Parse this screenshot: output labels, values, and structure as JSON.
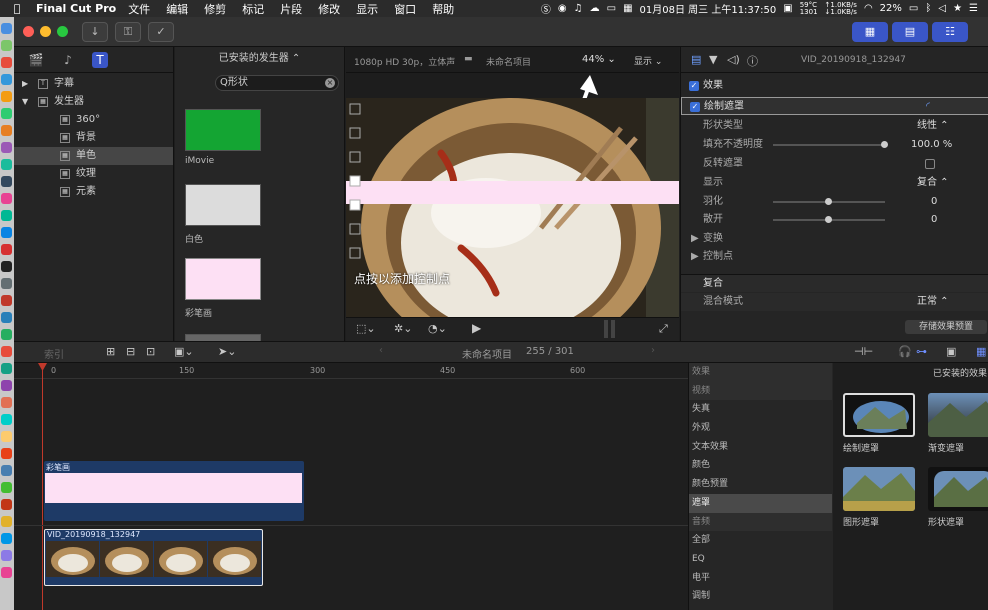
{
  "menubar": {
    "app_name": "Final Cut Pro",
    "items": [
      "文件",
      "编辑",
      "修剪",
      "标记",
      "片段",
      "修改",
      "显示",
      "窗口",
      "帮助"
    ],
    "clock": "01月08日 周三 上午11:37:50",
    "battery": "22%",
    "temp": "59°C\n1301",
    "net_up": "↑1.0KB/s",
    "net_down": "↓1.0KB/s"
  },
  "toolbar": {
    "import_icon": "download-icon",
    "keywords_icon": "key-icon",
    "background_tasks_icon": "check-circle-icon"
  },
  "library": {
    "tree": [
      {
        "label": "字幕",
        "level": 0,
        "collapsed": true,
        "icon_text": "T"
      },
      {
        "label": "发生器",
        "level": 0,
        "collapsed": false,
        "icon_text": "▦"
      },
      {
        "label": "360°",
        "level": 1,
        "icon_text": "▦"
      },
      {
        "label": "背景",
        "level": 1,
        "icon_text": "▦"
      },
      {
        "label": "单色",
        "level": 1,
        "selected": true,
        "icon_text": "▦"
      },
      {
        "label": "纹理",
        "level": 1,
        "icon_text": "▦"
      },
      {
        "label": "元素",
        "level": 1,
        "icon_text": "▦"
      }
    ]
  },
  "generators": {
    "header": "已安装的发生器 ⌃",
    "search_value": "Q形状",
    "items": [
      {
        "label": "iMovie",
        "color": "#14a533"
      },
      {
        "label": "白色",
        "color": "#dcdcdc"
      },
      {
        "label": "彩笔画",
        "color": "#fde0f4"
      }
    ]
  },
  "viewer": {
    "format": "1080p HD 30p，立体声",
    "project": "未命名项目",
    "zoom": "44% ⌄",
    "display": "显示 ⌄",
    "overlay_text": "点按以添加控制点",
    "band_color": "#fde0f4"
  },
  "inspector": {
    "clip_name": "VID_20190918_132947",
    "effects_label": "效果",
    "draw_mask_label": "绘制遮罩",
    "shape_type_label": "形状类型",
    "shape_type_value": "线性 ⌃",
    "fill_opacity_label": "填充不透明度",
    "fill_opacity_value": "100.0 %",
    "fill_opacity_level": 1.0,
    "invert_label": "反转遮罩",
    "display_label": "显示",
    "display_value": "复合 ⌃",
    "feather_label": "羽化",
    "feather_value": "0",
    "spread_label": "散开",
    "spread_value": "0",
    "transform_label": "变换",
    "control_points_label": "控制点",
    "composite_label": "复合",
    "blend_mode_label": "混合模式",
    "blend_mode_value": "正常 ⌃",
    "save_preset_label": "存储效果预置"
  },
  "timeline_toolbar": {
    "index_label": "索引",
    "project_name": "未命名项目",
    "counter": "255 / 301"
  },
  "timeline": {
    "ruler_ticks": [
      "0",
      "150",
      "300",
      "450",
      "600"
    ],
    "connected_clip_label": "彩笔画",
    "primary_clip_label": "VID_20190918_132947"
  },
  "effects_browser": {
    "header": "效果",
    "grid_header": "已安装的效果",
    "categories": [
      {
        "label": "视频",
        "head": true
      },
      {
        "label": "失真"
      },
      {
        "label": "外观"
      },
      {
        "label": "文本效果"
      },
      {
        "label": "颜色"
      },
      {
        "label": "颜色预置"
      },
      {
        "label": "遮罩",
        "selected": true
      },
      {
        "label": "音频",
        "head": true
      },
      {
        "label": "全部"
      },
      {
        "label": "EQ"
      },
      {
        "label": "电平"
      },
      {
        "label": "调制"
      }
    ],
    "effects": [
      "绘制遮罩",
      "渐变遮罩",
      "图形遮罩",
      "形状遮罩"
    ]
  }
}
